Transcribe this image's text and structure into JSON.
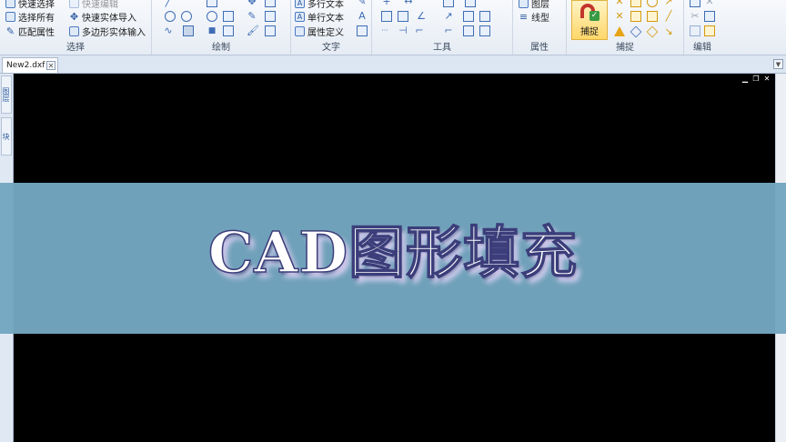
{
  "ribbon": {
    "select": {
      "label": "选择",
      "items": [
        "快速选择",
        "选择所有",
        "匹配属性"
      ],
      "items2": [
        "快速编辑",
        "快速实体导入",
        "多边形实体输入"
      ]
    },
    "draw": {
      "label": "绘制"
    },
    "text": {
      "label": "文字",
      "items": [
        "多行文本",
        "单行文本",
        "属性定义"
      ]
    },
    "tools": {
      "label": "工具"
    },
    "properties": {
      "label": "属性",
      "items": [
        "图层",
        "线型"
      ]
    },
    "snap": {
      "label": "捕捉",
      "capture_button": "捕捉"
    },
    "edit": {
      "label": "编辑"
    }
  },
  "tabstrip": {
    "tabs": [
      {
        "label": "New2.dxf"
      }
    ]
  },
  "side_panel": {
    "buttons": [
      "图层",
      "块"
    ]
  },
  "canvas": {
    "background": "#000000"
  },
  "banner": {
    "title": "CAD图形填充",
    "color": "#74a6c0"
  }
}
